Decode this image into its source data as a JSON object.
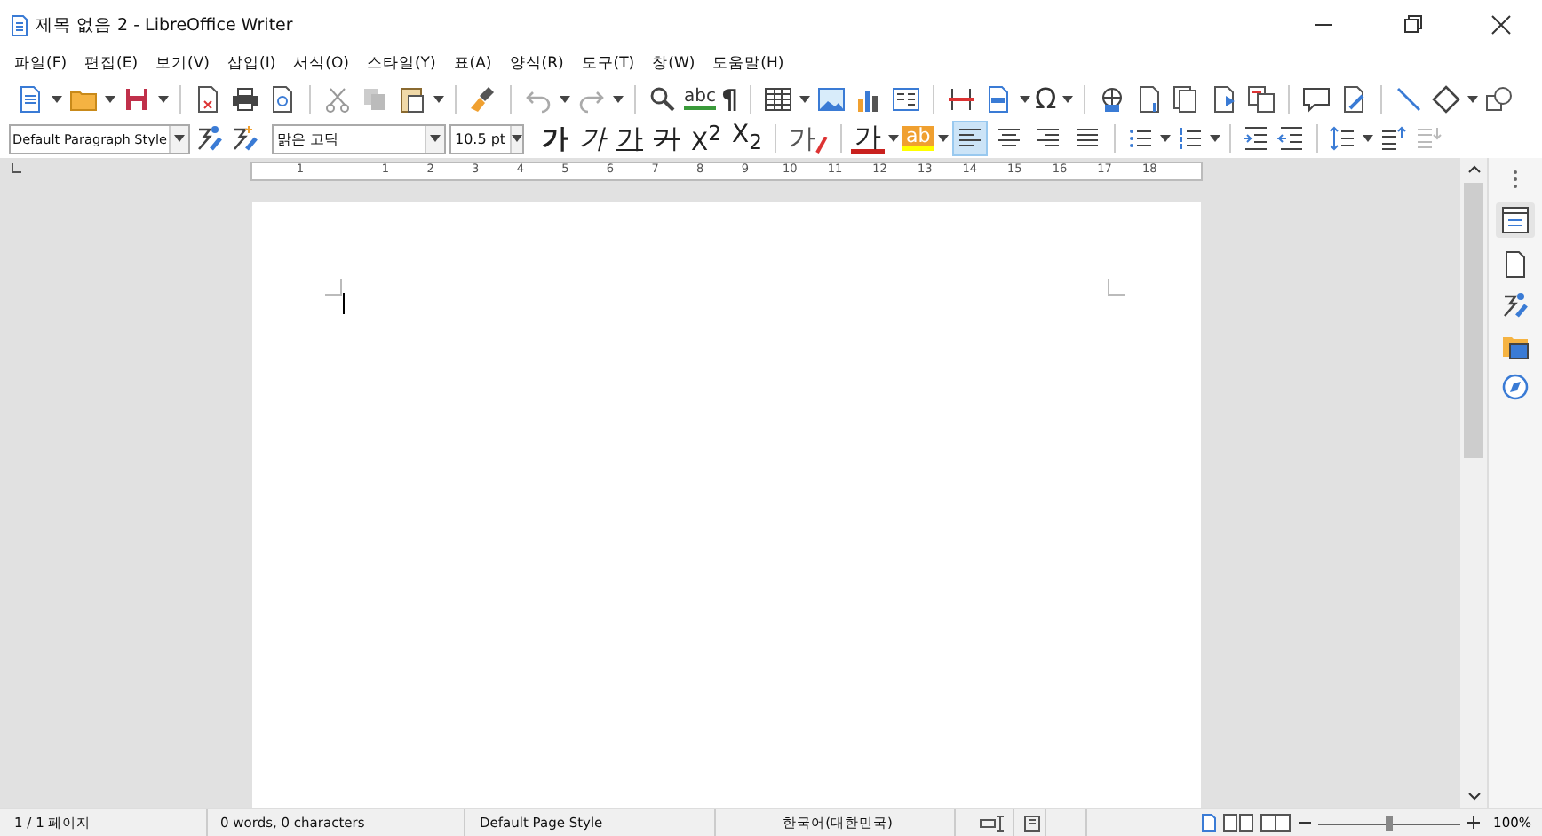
{
  "window": {
    "title": "제목 없음 2 - LibreOffice Writer"
  },
  "menu": [
    "파일(F)",
    "편집(E)",
    "보기(V)",
    "삽입(I)",
    "서식(O)",
    "스타일(Y)",
    "표(A)",
    "양식(R)",
    "도구(T)",
    "창(W)",
    "도움말(H)"
  ],
  "standard_toolbar": {
    "spellcheck": "abc",
    "formatting_marks": "¶",
    "special_character": "Ω"
  },
  "formatting_toolbar": {
    "paragraph_style": "Default Paragraph Style",
    "font_name": "맑은 고딕",
    "font_size": "10.5 pt",
    "bold": "가",
    "italic": "가",
    "underline": "가",
    "strikethrough": "가",
    "superscript": "X$^{2}$",
    "subscript": "X$_{2}$",
    "clear_formatting": "가",
    "font_color": "가",
    "highlighting": "ab",
    "alignment": [
      {
        "selected": true
      },
      {
        "selected": false
      },
      {
        "selected": false
      },
      {
        "selected": false
      }
    ]
  },
  "ruler": [
    "1",
    "1",
    "2",
    "3",
    "4",
    "5",
    "6",
    "7",
    "8",
    "9",
    "10",
    "11",
    "12",
    "13",
    "14",
    "15",
    "16",
    "17",
    "18"
  ],
  "status_bar": {
    "page": "1 / 1 페이지",
    "word_count": "0 words, 0 characters",
    "page_style": "Default Page Style",
    "language": "한국어(대한민국)",
    "zoom": {
      "level": 0.5
    },
    "zoom_percent": "100%"
  }
}
